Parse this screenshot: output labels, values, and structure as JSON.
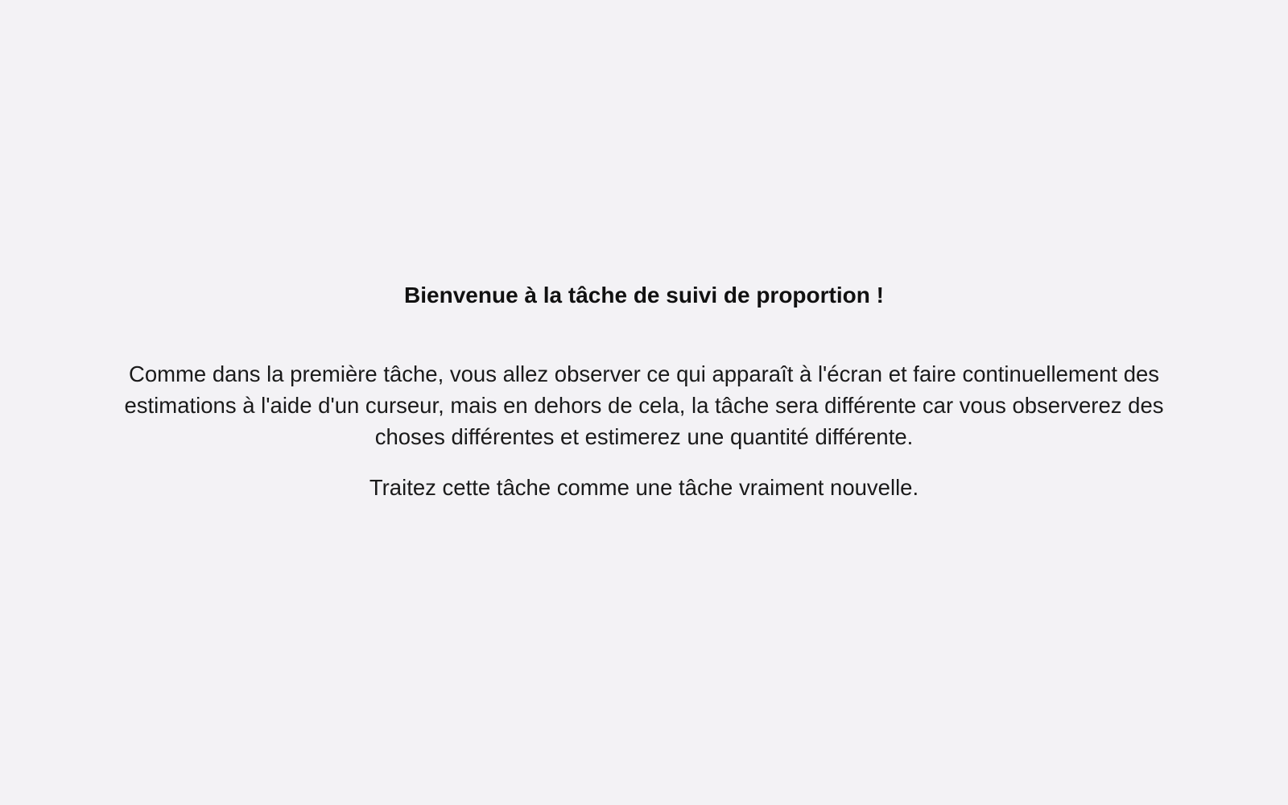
{
  "instructions": {
    "title": "Bienvenue à la tâche de suivi de proportion !",
    "paragraphs": [
      "Comme dans la première tâche, vous allez observer ce qui apparaît à l'écran et faire continuellement des estimations à l'aide d'un curseur, mais en dehors de cela, la tâche sera différente car vous observerez des choses différentes et estimerez une quantité différente.",
      "Traitez cette tâche comme une tâche vraiment nouvelle."
    ]
  },
  "colors": {
    "background": "#f3f2f5",
    "text": "#1a1a1a"
  }
}
